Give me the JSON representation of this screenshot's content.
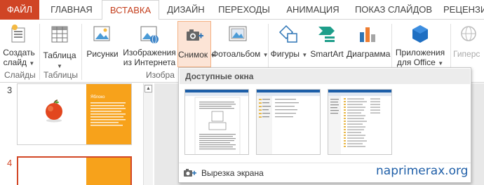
{
  "tabs": [
    "ФАЙЛ",
    "ГЛАВНАЯ",
    "ВСТАВКА",
    "ДИЗАЙН",
    "ПЕРЕХОДЫ",
    "АНИМАЦИЯ",
    "ПОКАЗ СЛАЙДОВ",
    "РЕЦЕНЗИ"
  ],
  "ribbon": {
    "new_slide": [
      "Создать",
      "слайд"
    ],
    "table": "Таблица",
    "pictures": "Рисунки",
    "online_pictures": [
      "Изображения",
      "из Интернета"
    ],
    "screenshot": "Снимок",
    "photo_album": "Фотоальбом",
    "shapes": "Фигуры",
    "smartart": "SmartArt",
    "chart": "Диаграмма",
    "apps": [
      "Приложения",
      "для Office"
    ],
    "hyperlink": "Гиперс",
    "groups": {
      "slides": "Слайды",
      "tables": "Таблицы",
      "images": "Изобра"
    }
  },
  "slides": [
    {
      "num": "3",
      "thumb_title": "Яблоко"
    },
    {
      "num": "4"
    }
  ],
  "dropdown": {
    "header": "Доступные окна",
    "clipping": "Вырезка экрана"
  },
  "watermark": "naprimerax.org",
  "colors": {
    "file_tab": "#d04525",
    "active_tab_text": "#c43e1c",
    "screenshot_hot": "#fce4d6",
    "slide_accent": "#f7a21b",
    "selected_slide_border": "#d24726",
    "watermark": "#1f5fa8"
  }
}
